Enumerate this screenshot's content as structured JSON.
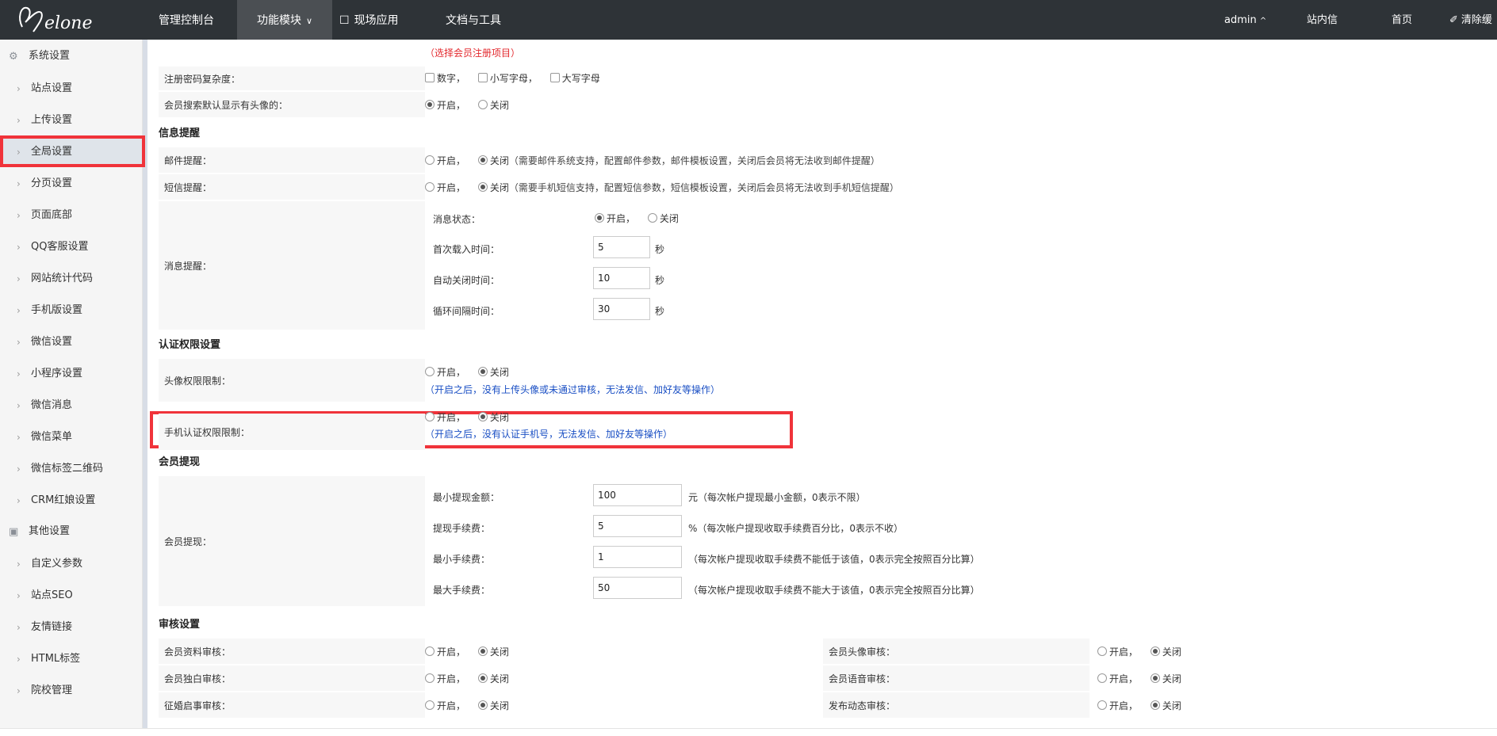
{
  "nav": {
    "items": [
      {
        "label": "管理控制台"
      },
      {
        "label": "功能模块"
      },
      {
        "label": "现场应用"
      },
      {
        "label": "文档与工具"
      }
    ],
    "right": {
      "user": "admin",
      "messages": "站内信",
      "home": "首页",
      "clear_cache": "清除缓"
    }
  },
  "sidebar": {
    "group1": "系统设置",
    "group1_items": [
      "站点设置",
      "上传设置",
      "全局设置",
      "分页设置",
      "页面底部",
      "QQ客服设置",
      "网站统计代码",
      "手机版设置",
      "微信设置",
      "小程序设置",
      "微信消息",
      "微信菜单",
      "微信标签二维码",
      "CRM红娘设置"
    ],
    "group2": "其他设置",
    "group2_items": [
      "自定义参数",
      "站点SEO",
      "友情链接",
      "HTML标签",
      "院校管理"
    ],
    "selected": "全局设置"
  },
  "content": {
    "top_hint": "（选择会员注册项目）",
    "pwd_label": "注册密码复杂度：",
    "pwd_opts": [
      "数字，",
      "小写字母，",
      "大写字母"
    ],
    "avatar_search_label": "会员搜索默认显示有头像的：",
    "open": "开启，",
    "close": "关闭",
    "sec_info": "信息提醒",
    "mail_label": "邮件提醒：",
    "mail_hint": "（需要邮件系统支持，配置邮件参数，邮件模板设置，关闭后会员将无法收到邮件提醒）",
    "sms_label": "短信提醒：",
    "sms_hint": "（需要手机短信支持，配置短信参数，短信模板设置，关闭后会员将无法收到手机短信提醒）",
    "msg_label": "消息提醒：",
    "msg_status": "消息状态：",
    "msg_first": "首次载入时间：",
    "msg_first_val": "5",
    "msg_auto": "自动关闭时间：",
    "msg_auto_val": "10",
    "msg_cycle": "循环间隔时间：",
    "msg_cycle_val": "30",
    "sec_unit": "秒",
    "sec_auth": "认证权限设置",
    "avatar_auth_label": "头像权限限制：",
    "avatar_auth_hint": "（开启之后，没有上传头像或未通过审核，无法发信、加好友等操作）",
    "phone_auth_label": "手机认证权限限制：",
    "phone_auth_hint": "（开启之后，没有认证手机号，无法发信、加好友等操作）",
    "sec_withdraw": "会员提现",
    "withdraw_label": "会员提现：",
    "wd_min_label": "最小提现金额：",
    "wd_min_val": "100",
    "wd_min_unit": "元（每次帐户提现最小金额，0表示不限）",
    "wd_fee_label": "提现手续费：",
    "wd_fee_val": "5",
    "wd_fee_unit": "%（每次帐户提现收取手续费百分比，0表示不收）",
    "wd_minfee_label": "最小手续费：",
    "wd_minfee_val": "1",
    "wd_minfee_unit": "（每次帐户提现收取手续费不能低于该值，0表示完全按照百分比算）",
    "wd_maxfee_label": "最大手续费：",
    "wd_maxfee_val": "50",
    "wd_maxfee_unit": "（每次帐户提现收取手续费不能大于该值，0表示完全按照百分比算）",
    "sec_audit": "审核设置",
    "audit_left": [
      "会员资料审核：",
      "会员独白审核：",
      "征婚启事审核："
    ],
    "audit_right": [
      "会员头像审核：",
      "会员语音审核：",
      "发布动态审核："
    ]
  },
  "icons": {
    "gear": "gear-icon",
    "box": "box-icon",
    "brush": "brush-icon",
    "chevron": "chevron-right-icon"
  },
  "colors": {
    "topbar": "#2e3337",
    "highlight": "#f0333a",
    "hint_blue": "#1a4fc4",
    "hint_red": "#e3282d"
  }
}
